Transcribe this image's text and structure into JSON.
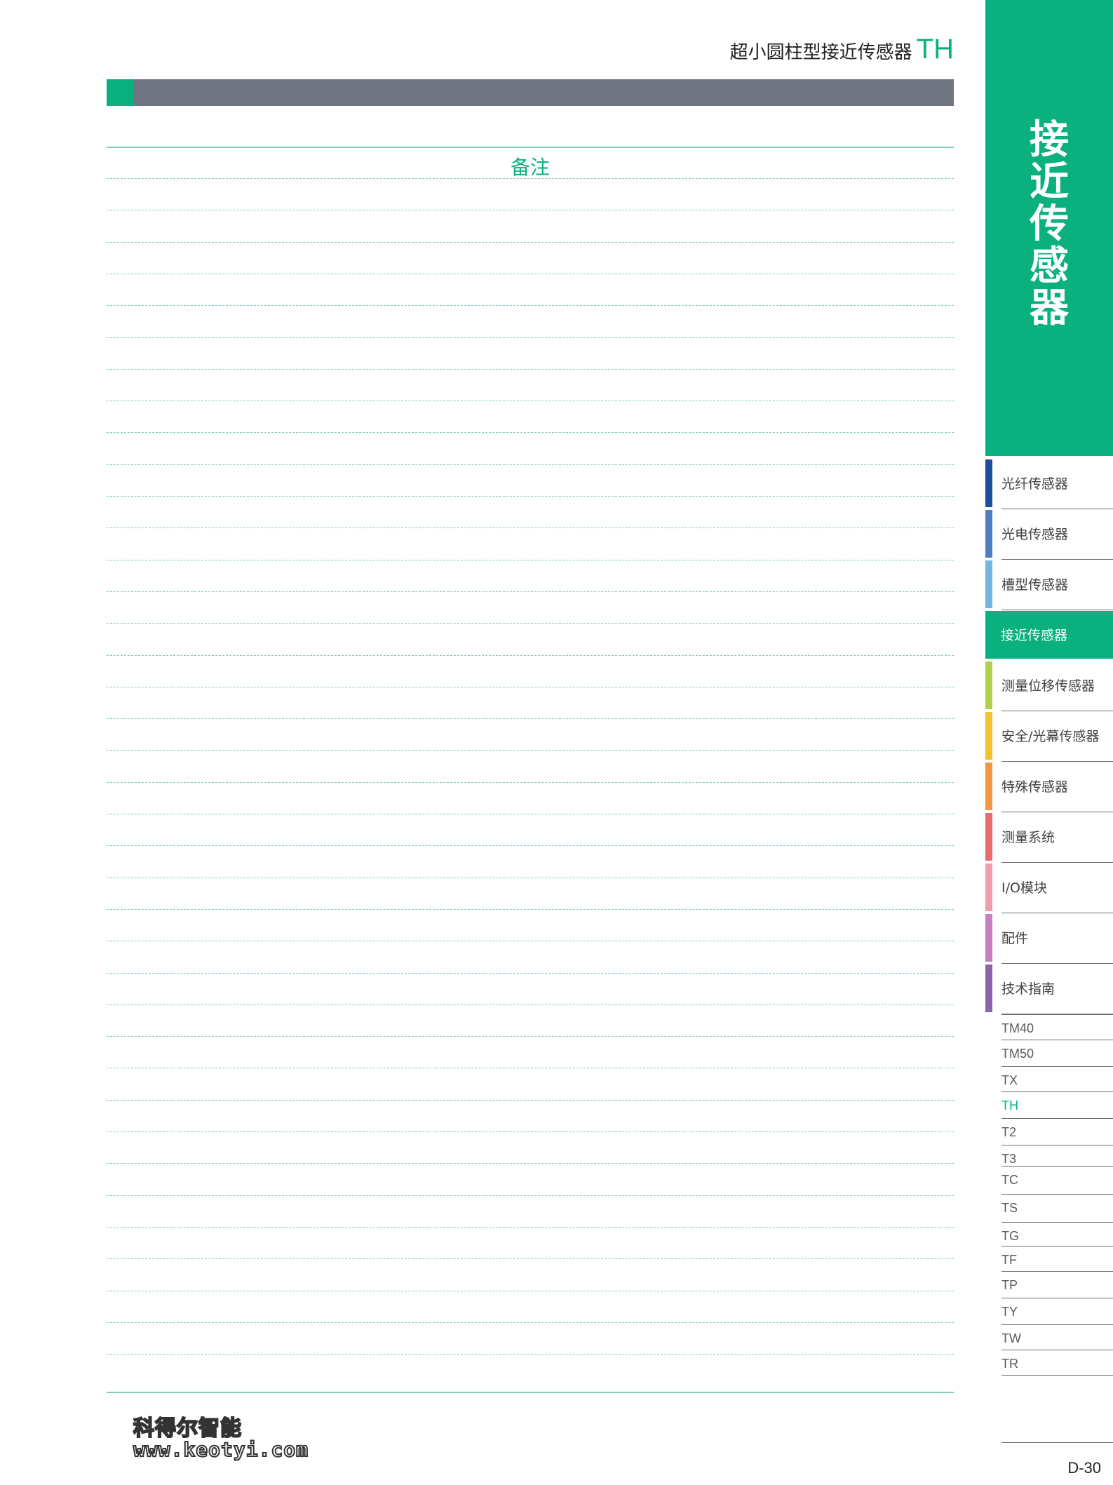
{
  "header": {
    "title": "超小圆柱型接近传感器",
    "model": "TH"
  },
  "notes": {
    "heading": "备注",
    "line_count": 38
  },
  "side_panel": {
    "title_chars": [
      "接",
      "近",
      "传",
      "感",
      "器"
    ]
  },
  "categories": [
    {
      "label": "光纤传感器",
      "color": "#1d4f9e"
    },
    {
      "label": "光电传感器",
      "color": "#4f7cc0"
    },
    {
      "label": "槽型传感器",
      "color": "#72b7e4"
    },
    {
      "label": "接近传感器",
      "color": "#0bb07f",
      "active": true
    },
    {
      "label": "测量位移传感器",
      "color": "#b1cf4b"
    },
    {
      "label": "安全/光幕传感器",
      "color": "#f5c12e"
    },
    {
      "label": "特殊传感器",
      "color": "#ef9745"
    },
    {
      "label": "测量系统",
      "color": "#e96a6f"
    },
    {
      "label": "I/O模块",
      "color": "#f29bb0"
    },
    {
      "label": "配件",
      "color": "#c77fbf"
    },
    {
      "label": "技术指南",
      "color": "#8a63a9"
    }
  ],
  "models": [
    {
      "label": "TM40"
    },
    {
      "label": "TM50"
    },
    {
      "label": "TX"
    },
    {
      "label": "TH",
      "active": true
    },
    {
      "label": "T2"
    },
    {
      "label": "T3"
    },
    {
      "label": "TC"
    },
    {
      "label": "TS"
    },
    {
      "label": "TG"
    },
    {
      "label": "TF"
    },
    {
      "label": "TP"
    },
    {
      "label": "TY"
    },
    {
      "label": "TW"
    },
    {
      "label": "TR"
    }
  ],
  "page_number": "D-30",
  "watermark": {
    "name": "科得尔智能",
    "url": "www.keotyi.com"
  },
  "colors": {
    "accent": "#0bb07f",
    "title_bar": "#6f7581"
  }
}
